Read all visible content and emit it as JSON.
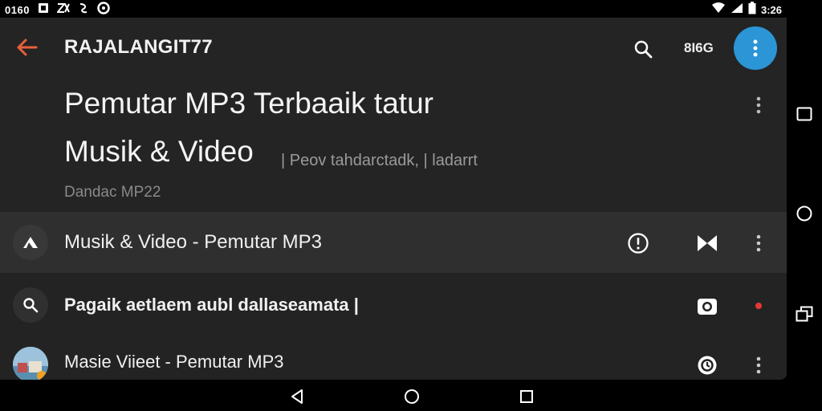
{
  "status_bar": {
    "left_text": "0160",
    "time": "3:26"
  },
  "app_bar": {
    "title": "RAJALANGIT77",
    "count_text": "8I6G"
  },
  "header": {
    "heading_line1": "Pemutar MP3 Terbaaik tatur",
    "heading_line2": "Musik & Video",
    "heading_sub": "| Peov tahdarctadk, | ladarrt",
    "subtitle": "Dandac MP22"
  },
  "list": [
    {
      "text": "Musik & Video - Pemutar MP3",
      "icon": "triangle-logo-icon",
      "action1": "alert-circle-icon",
      "action2": "bowtie-icon"
    },
    {
      "text": "Pagaik aetlaem aubl dallaseamata |",
      "icon": "search-icon",
      "action1": "camera-icon",
      "action2": "record-dot-icon"
    },
    {
      "text": "Masie Viieet - Pemutar MP3",
      "icon": "avatar",
      "action1": "clock-icon",
      "action2": "more-icon"
    }
  ],
  "colors": {
    "accent_blue": "#2b95d6",
    "back_arrow": "#e8603c",
    "record_dot": "#e53935",
    "background": "#222222"
  }
}
